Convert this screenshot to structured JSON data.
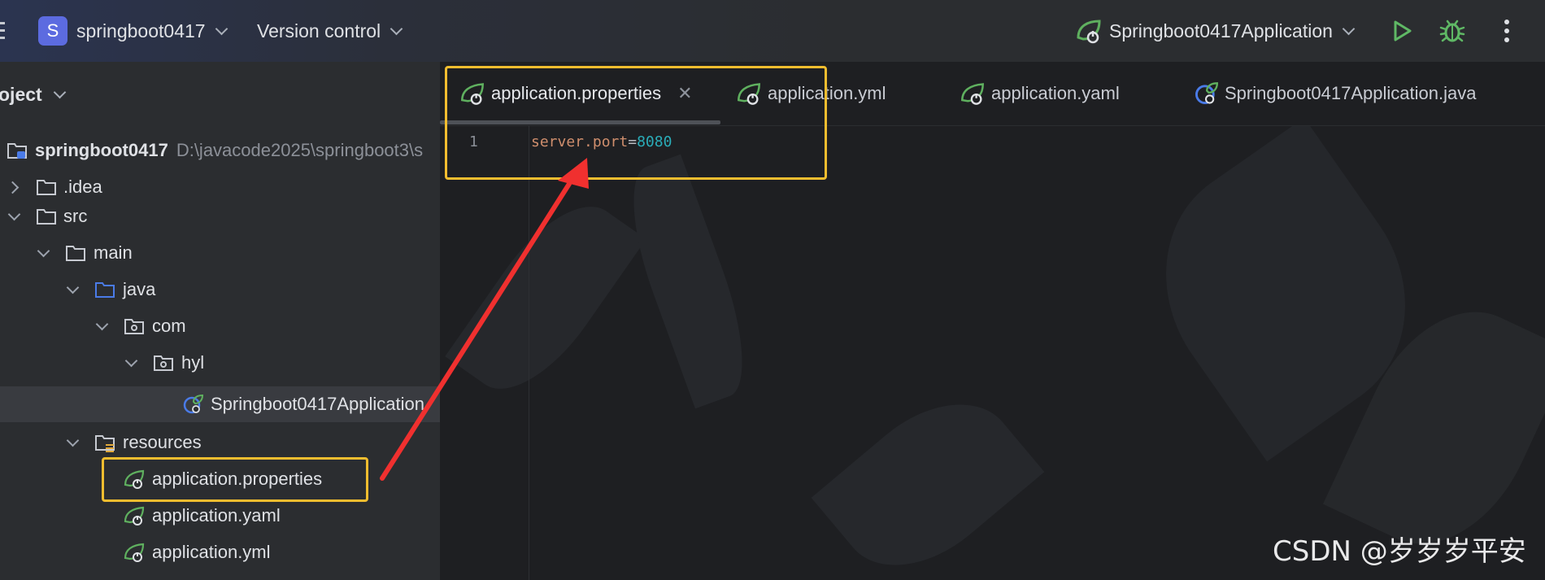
{
  "toolbar": {
    "project_badge": "S",
    "project_name": "springboot0417",
    "version_control": "Version control",
    "run_config": "Springboot0417Application",
    "run_icon": "play-icon",
    "debug_icon": "bug-icon",
    "more_icon": "kebab-menu-icon",
    "accent": "#5c6be0"
  },
  "project_pane": {
    "title": "oject",
    "root": {
      "label": "springboot0417",
      "path": "D:\\javacode2025\\springboot3\\s"
    },
    "items": [
      {
        "label": ".idea",
        "icon": "folder-icon",
        "state": "collapsed"
      },
      {
        "label": "src",
        "icon": "folder-icon",
        "state": "expanded"
      },
      {
        "label": "main",
        "icon": "folder-icon",
        "state": "expanded"
      },
      {
        "label": "java",
        "icon": "source-folder-icon",
        "state": "expanded"
      },
      {
        "label": "com",
        "icon": "package-icon",
        "state": "expanded"
      },
      {
        "label": "hyl",
        "icon": "package-icon",
        "state": "expanded"
      },
      {
        "label": "Springboot0417Application",
        "icon": "spring-class-icon",
        "state": "leaf"
      },
      {
        "label": "resources",
        "icon": "resources-folder-icon",
        "state": "expanded"
      },
      {
        "label": "application.properties",
        "icon": "spring-config-icon",
        "state": "leaf"
      },
      {
        "label": "application.yaml",
        "icon": "spring-config-icon",
        "state": "leaf"
      },
      {
        "label": "application.yml",
        "icon": "spring-config-icon",
        "state": "leaf"
      }
    ]
  },
  "editor": {
    "tabs": [
      {
        "label": "application.properties",
        "active": true
      },
      {
        "label": "application.yml",
        "active": false
      },
      {
        "label": "application.yaml",
        "active": false
      },
      {
        "label": "Springboot0417Application.java",
        "active": false
      }
    ],
    "close_glyph": "✕",
    "line_number": "1",
    "code": {
      "key": "server.port",
      "eq": "=",
      "value": "8080"
    }
  },
  "annotations": {
    "highlight_color": "#f2bd2f",
    "arrow_color": "#f0302f"
  },
  "watermark": "CSDN @岁岁岁平安"
}
